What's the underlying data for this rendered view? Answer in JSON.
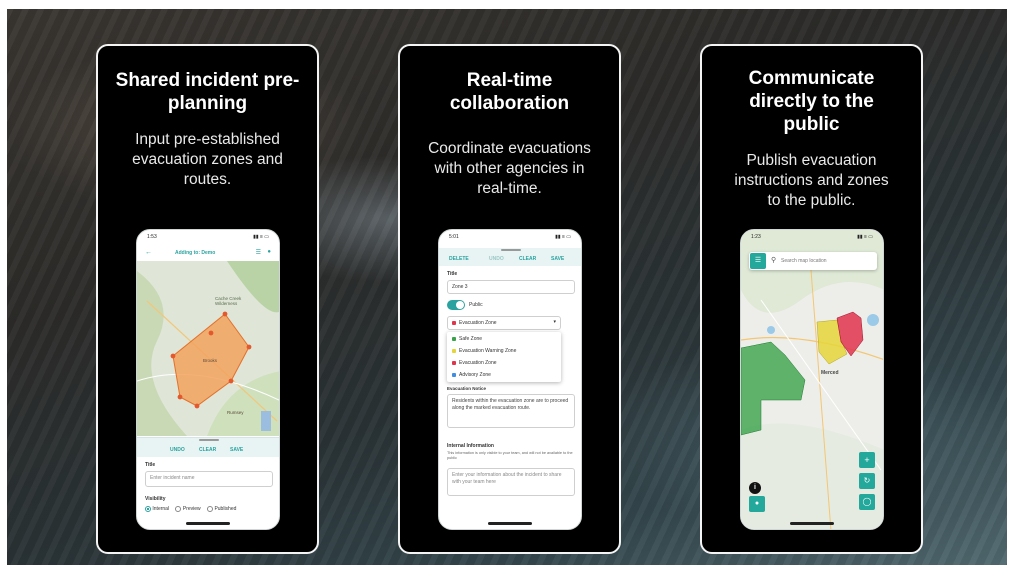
{
  "colors": {
    "accent": "#2aa3a0",
    "safe": "#3aa24a",
    "warning": "#e5d53a",
    "evac": "#e0344d",
    "advisory": "#3f8ee0",
    "pre_zone": "#f3a25e"
  },
  "cards": [
    {
      "title": "Shared incident pre-planning",
      "description": "Input pre-established evacuation zones and routes.",
      "phone": {
        "time": "1:53",
        "signal": "▮▮ ≡ ▭",
        "header": "Adding to: Demo",
        "map_label_1": "Cache Creek Wilderness",
        "map_label_2": "Brooks",
        "map_label_3": "Rumsey",
        "tools": [
          "UNDO",
          "CLEAR",
          "SAVE"
        ],
        "title_label": "Title",
        "title_placeholder": "Enter incident name",
        "visibility_label": "Visibility",
        "visibility_options": [
          "Internal",
          "Preview",
          "Published"
        ]
      }
    },
    {
      "title": "Real-time collaboration",
      "description": "Coordinate evacuations with other agencies in real-time.",
      "phone": {
        "time": "5:01",
        "signal": "▮▮ ≡ ▭",
        "tools": [
          "DELETE",
          "UNDO",
          "CLEAR",
          "SAVE"
        ],
        "title_label": "Title",
        "title_value": "Zone 3",
        "public_label": "Public",
        "selected_zone": "Evacuation Zone",
        "zone_options": [
          "Safe Zone",
          "Evacuation Warning Zone",
          "Evacuation Zone",
          "Advisory Zone"
        ],
        "notice_label": "Evacuation Notice",
        "notice_text": "Residents within the evacuation zone are to proceed along the marked evacuation route.",
        "internal_label": "Internal Information",
        "internal_hint": "This information is only visible to your team, and will not be available to the public",
        "internal_placeholder": "Enter your information about the incident to share with your team here"
      }
    },
    {
      "title": "Communicate directly to the public",
      "description": "Publish evacuation instructions and zones to the public.",
      "phone": {
        "time": "1:23",
        "signal": "▮▮ ≡ ▭",
        "search_placeholder": "Search map location",
        "town_label": "Merced"
      }
    }
  ]
}
